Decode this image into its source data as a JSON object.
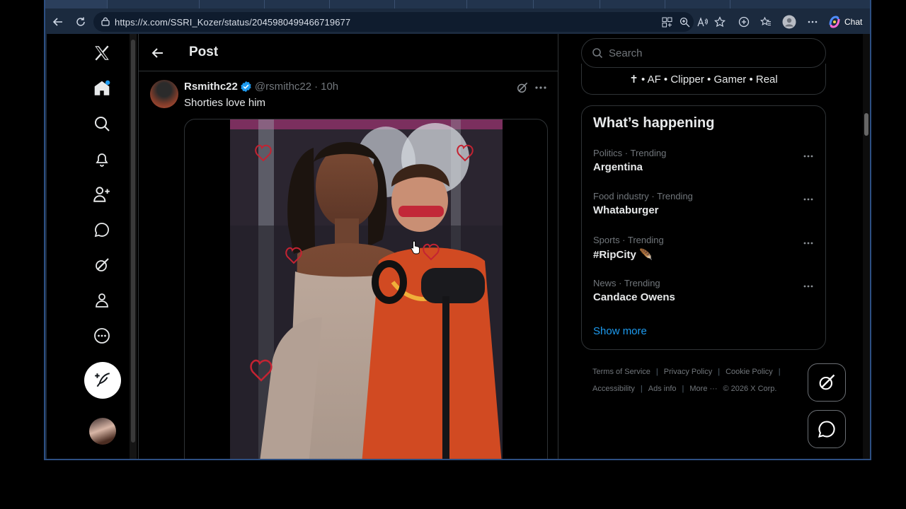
{
  "browser": {
    "url": "https://x.com/SSRI_Kozer/status/2045980499466719677",
    "chat_label": "Chat"
  },
  "header": {
    "title": "Post"
  },
  "tweet": {
    "author_name": "Rsmithc22",
    "handle": "@rsmithc22",
    "dot": "·",
    "time": "10h",
    "text": "Shorties love him"
  },
  "sidebar": {
    "search_placeholder": "Search",
    "bio_line": "✝ • AF • Clipper • Gamer • Real",
    "trends_title": "What’s happening",
    "trends": [
      {
        "meta": "Politics · Trending",
        "name": "Argentina"
      },
      {
        "meta": "Food industry · Trending",
        "name": "Whataburger"
      },
      {
        "meta": "Sports · Trending",
        "name": "#RipCity 🪶"
      },
      {
        "meta": "News · Trending",
        "name": "Candace Owens"
      }
    ],
    "show_more": "Show more",
    "footer": {
      "terms": "Terms of Service",
      "privacy": "Privacy Policy",
      "cookie": "Cookie Policy",
      "accessibility": "Accessibility",
      "ads": "Ads info",
      "more": "More ···",
      "copyright": "© 2026 X Corp."
    }
  },
  "colors": {
    "accent": "#1d9bf0",
    "background": "#000000",
    "text": "#e7e9ea",
    "muted": "#71767b",
    "border": "#2f3336",
    "browser_frame": "#1b2a3e"
  }
}
